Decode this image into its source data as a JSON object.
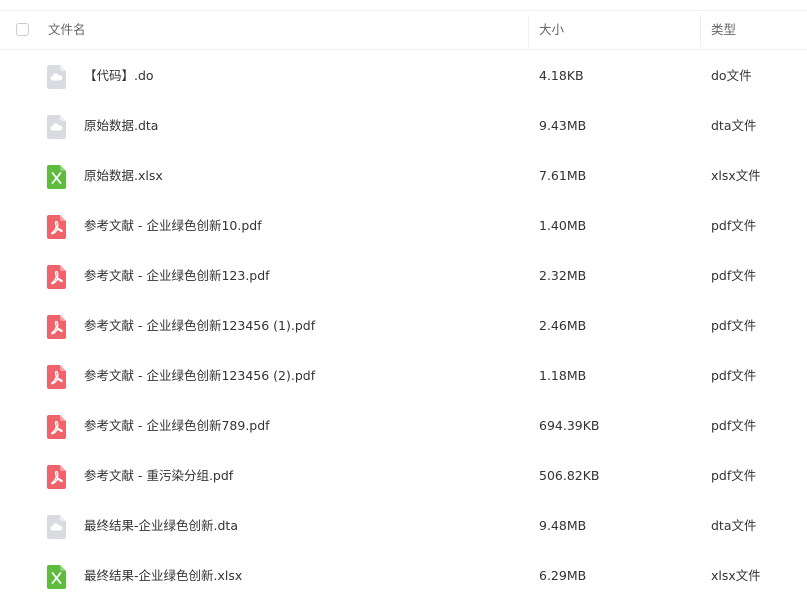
{
  "header": {
    "name_label": "文件名",
    "size_label": "大小",
    "type_label": "类型"
  },
  "colors": {
    "text": "#333333",
    "header_text": "#666666",
    "pdf_icon": "#f0636b",
    "xlsx_icon": "#5dbb3d",
    "generic_icon": "#d9dbe0"
  },
  "files": [
    {
      "name": "【代码】.do",
      "size": "4.18KB",
      "type": "do文件",
      "icon": "generic-file-icon"
    },
    {
      "name": "原始数据.dta",
      "size": "9.43MB",
      "type": "dta文件",
      "icon": "generic-file-icon"
    },
    {
      "name": "原始数据.xlsx",
      "size": "7.61MB",
      "type": "xlsx文件",
      "icon": "excel-file-icon"
    },
    {
      "name": "参考文献 - 企业绿色创新10.pdf",
      "size": "1.40MB",
      "type": "pdf文件",
      "icon": "pdf-file-icon"
    },
    {
      "name": "参考文献 - 企业绿色创新123.pdf",
      "size": "2.32MB",
      "type": "pdf文件",
      "icon": "pdf-file-icon"
    },
    {
      "name": "参考文献 - 企业绿色创新123456 (1).pdf",
      "size": "2.46MB",
      "type": "pdf文件",
      "icon": "pdf-file-icon"
    },
    {
      "name": "参考文献 - 企业绿色创新123456 (2).pdf",
      "size": "1.18MB",
      "type": "pdf文件",
      "icon": "pdf-file-icon"
    },
    {
      "name": "参考文献 - 企业绿色创新789.pdf",
      "size": "694.39KB",
      "type": "pdf文件",
      "icon": "pdf-file-icon"
    },
    {
      "name": "参考文献 - 重污染分组.pdf",
      "size": "506.82KB",
      "type": "pdf文件",
      "icon": "pdf-file-icon"
    },
    {
      "name": "最终结果-企业绿色创新.dta",
      "size": "9.48MB",
      "type": "dta文件",
      "icon": "generic-file-icon"
    },
    {
      "name": "最终结果-企业绿色创新.xlsx",
      "size": "6.29MB",
      "type": "xlsx文件",
      "icon": "excel-file-icon"
    }
  ]
}
